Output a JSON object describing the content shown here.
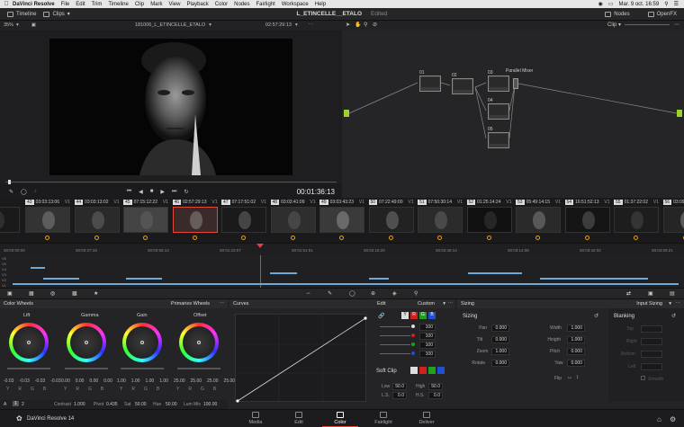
{
  "menubar": {
    "app": "DaVinci Resolve",
    "menus": [
      "File",
      "Edit",
      "Trim",
      "Timeline",
      "Clip",
      "Mark",
      "View",
      "Playback",
      "Color",
      "Nodes",
      "Fairlight",
      "Workspace",
      "Help"
    ],
    "datetime": "Mar. 9 oct.  16:59"
  },
  "toolbar": {
    "timeline": "Timeline",
    "clips": "Clips",
    "project": "L_ETINCELLE__ETALO",
    "edited": "Edited",
    "nodes": "Nodes",
    "openfx": "OpenFX"
  },
  "viewer": {
    "zoom": "35%",
    "clip_name": "181006_L_ETINCELLE_ETALO",
    "timecode_top": "02:57:29:13",
    "timecode": "00:01:36:13"
  },
  "nodes": {
    "mode": "Clip",
    "items": [
      {
        "label": "01",
        "id": "01"
      },
      {
        "label": "02",
        "id": "02"
      },
      {
        "label": "03",
        "id": "03"
      },
      {
        "label": "Parallel Mixer",
        "id": "pm"
      },
      {
        "label": "04",
        "id": "04"
      },
      {
        "label": "05",
        "id": "05"
      }
    ]
  },
  "clips": [
    {
      "num": "",
      "tc": "33:11",
      "track": ""
    },
    {
      "num": "43",
      "tc": "03:03:13:06",
      "track": "V1"
    },
    {
      "num": "44",
      "tc": "03:03:13:02",
      "track": "V1"
    },
    {
      "num": "45",
      "tc": "07:15:12:22",
      "track": "V1"
    },
    {
      "num": "46",
      "tc": "02:57:29:13",
      "track": "V1"
    },
    {
      "num": "47",
      "tc": "07:17:51:02",
      "track": "V1"
    },
    {
      "num": "48",
      "tc": "03:03:41:09",
      "track": "V1"
    },
    {
      "num": "49",
      "tc": "03:03:43:23",
      "track": "V1"
    },
    {
      "num": "50",
      "tc": "07:22:49:00",
      "track": "V1"
    },
    {
      "num": "51",
      "tc": "07:50:30:14",
      "track": "V1"
    },
    {
      "num": "52",
      "tc": "01:25:14:24",
      "track": "V1"
    },
    {
      "num": "53",
      "tc": "05:49:14:15",
      "track": "V1"
    },
    {
      "num": "54",
      "tc": "16:51:52:13",
      "track": "V1"
    },
    {
      "num": "55",
      "tc": "01:37:22:02",
      "track": "V1"
    },
    {
      "num": "56",
      "tc": "03:09:",
      "track": ""
    }
  ],
  "ruler": [
    "00:00:00:00",
    "00:00:27:19",
    "00:00:55:13",
    "00:01:23:07",
    "00:01:51:01",
    "00:02:18:20",
    "00:02:46:14",
    "00:03:14:08",
    "00:03:42:02",
    "00:04:09:21"
  ],
  "tracks": [
    "V6",
    "V5",
    "V4",
    "V3",
    "V2",
    "V1"
  ],
  "colorwheels": {
    "title": "Color Wheels",
    "mode": "Primaries Wheels",
    "wheels": [
      {
        "name": "Lift",
        "vals": [
          "-0.03",
          "-0.03",
          "-0.03",
          "-0.03"
        ]
      },
      {
        "name": "Gamma",
        "vals": [
          "0.00",
          "0.00",
          "0.00",
          "0.00"
        ]
      },
      {
        "name": "Gain",
        "vals": [
          "1.00",
          "1.00",
          "1.00",
          "1.00"
        ]
      },
      {
        "name": "Offset",
        "vals": [
          "25.00",
          "25.00",
          "25.00",
          "25.00"
        ]
      }
    ],
    "channels": [
      "Y",
      "R",
      "G",
      "B"
    ],
    "footer": {
      "a": "A",
      "p1": "1",
      "p2": "2",
      "contrast_label": "Contrast",
      "contrast": "1.000",
      "pivot_label": "Pivot",
      "pivot": "0.435",
      "sat_label": "Sat",
      "sat": "50.00",
      "hue_label": "Hue",
      "hue": "50.00",
      "lummix_label": "Lum Mix",
      "lummix": "100.00"
    }
  },
  "curves": {
    "title": "Curves",
    "edit": "Edit",
    "custom": "Custom",
    "values": [
      "100",
      "100",
      "100",
      "100"
    ],
    "softclip": "Soft Clip",
    "low_label": "Low",
    "low": "50.0",
    "high_label": "High",
    "high": "50.0",
    "ls_label": "L.S.",
    "ls": "0.0",
    "hs_label": "H.S.",
    "hs": "0.0"
  },
  "sizing": {
    "title": "Sizing",
    "mode": "Input Sizing",
    "section": "Sizing",
    "fields": [
      {
        "label": "Pan",
        "val": "0.000"
      },
      {
        "label": "Tilt",
        "val": "0.000"
      },
      {
        "label": "Zoom",
        "val": "1.000"
      },
      {
        "label": "Rotate",
        "val": "0.000"
      }
    ],
    "fields2": [
      {
        "label": "Width",
        "val": "1.000"
      },
      {
        "label": "Height",
        "val": "1.000"
      },
      {
        "label": "Pitch",
        "val": "0.000"
      },
      {
        "label": "Yaw",
        "val": "0.000"
      }
    ],
    "flip": "Flip",
    "blanking": "Blanking",
    "blank_fields": [
      "Top",
      "Right",
      "Bottom",
      "Left"
    ],
    "smooth": "Smooth"
  },
  "bottom": {
    "app": "DaVinci Resolve 14",
    "pages": [
      "Media",
      "Edit",
      "Color",
      "Fairlight",
      "Deliver"
    ],
    "active": "Color"
  },
  "colors": {
    "accent": "#e5483a",
    "node_green": "#9bd32c",
    "clip_marker": "#e0a030",
    "playhead": "#e04040"
  }
}
